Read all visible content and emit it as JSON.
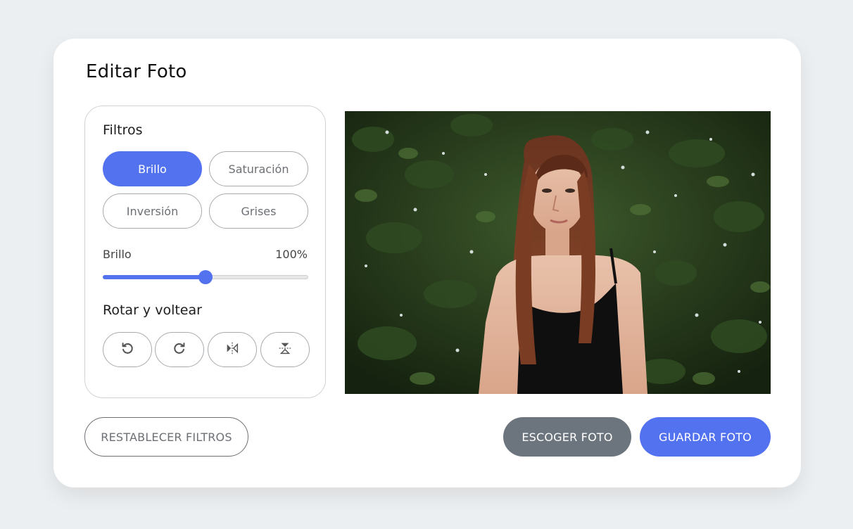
{
  "title": "Editar Foto",
  "filters": {
    "label": "Filtros",
    "options": [
      "Brillo",
      "Saturación",
      "Inversión",
      "Grises"
    ],
    "active_index": 0
  },
  "slider": {
    "name": "Brillo",
    "value_text": "100%",
    "fill_fraction": 0.5
  },
  "rotate": {
    "label": "Rotar y voltear",
    "buttons": [
      {
        "icon": "rotate-left-icon"
      },
      {
        "icon": "rotate-right-icon"
      },
      {
        "icon": "flip-horizontal-icon"
      },
      {
        "icon": "flip-vertical-icon"
      }
    ]
  },
  "buttons": {
    "reset": "RESTABLECER FILTROS",
    "choose": "ESCOGER FOTO",
    "save": "GUARDAR FOTO"
  },
  "colors": {
    "accent": "#5372f0",
    "secondary": "#6c757d",
    "background": "#eceff1"
  }
}
